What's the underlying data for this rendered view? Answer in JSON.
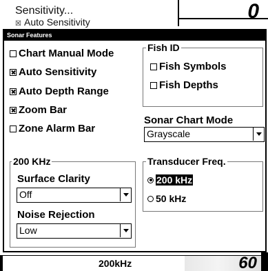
{
  "background": {
    "menu_item_1": "Sensitivity...",
    "menu_item_2_check": "☒",
    "menu_item_2": "Auto Sensitivity",
    "readout_digit": "0"
  },
  "dialog": {
    "title": "Sonar Features",
    "options": [
      {
        "label": "Chart Manual Mode",
        "checked": false
      },
      {
        "label": "Auto Sensitivity",
        "checked": true
      },
      {
        "label": "Auto Depth Range",
        "checked": true
      },
      {
        "label": "Zoom Bar",
        "checked": true
      },
      {
        "label": "Zone Alarm Bar",
        "checked": false
      }
    ],
    "fish_id": {
      "title": "Fish ID",
      "options": [
        {
          "label": "Fish Symbols",
          "checked": false
        },
        {
          "label": "Fish Depths",
          "checked": false
        }
      ]
    },
    "sonar_chart_mode": {
      "label": "Sonar Chart Mode",
      "value": "Grayscale"
    },
    "khz_group": {
      "title": "200 KHz",
      "surface_clarity_label": "Surface Clarity",
      "surface_clarity_value": "Off",
      "noise_rejection_label": "Noise Rejection",
      "noise_rejection_value": "Low"
    },
    "transducer": {
      "label": "Transducer Freq.",
      "options": [
        {
          "label": "200 kHz",
          "selected": true
        },
        {
          "label": "50 kHz",
          "selected": false
        }
      ]
    }
  },
  "status": {
    "frequency": "200kHz",
    "depth": "60"
  }
}
